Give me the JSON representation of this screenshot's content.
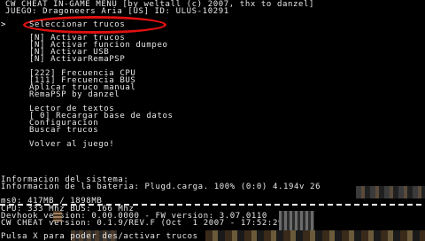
{
  "header": {
    "title": "CW CHEAT IN-GAME MENU [by weltall (c) 2007, thx to danzel]",
    "game": "JUEGO: Dragoneers Aria [US] ID: ULUS-10291"
  },
  "menu": {
    "cursor": ">",
    "items": [
      {
        "label": "Seleccionar trucos"
      },
      {
        "label": "[N] Activar trucos"
      },
      {
        "label": "[N] Activar funcion dumpeo"
      },
      {
        "label": "[N] Activar USB"
      },
      {
        "label": "[N] ActivarRemaPSP"
      },
      {
        "label": "[222] Frecuencia CPU"
      },
      {
        "label": "[111] Frecuencia BUS"
      },
      {
        "label": "Aplicar truco manual"
      },
      {
        "label": "RemaPSP by danzel"
      },
      {
        "label": "Lector de textos"
      },
      {
        "label": "[ 0] Recargar base de datos"
      },
      {
        "label": "Configuracion"
      },
      {
        "label": "Buscar trucos"
      },
      {
        "label": "Volver al juego!"
      }
    ]
  },
  "system": {
    "heading": "Informacion del sistema:",
    "battery": "Informacion de la bateria: Plugd.carga. 100% (0:0) 4.194v 26",
    "memory": "ms0: 417MB / 1898MB",
    "cpu": "CPU: 333 Mhz BUS: 166 Mhz",
    "devhook": "Devhook version: 0.00.0000 - FW version: 3.07.0110",
    "cwcheat": "CW CHEAT version: 0.1.9/REV.F (Oct  1 2007 - 17:52:29)"
  },
  "footer": {
    "hint": "Pulsa X para poder des/activar trucos"
  },
  "colors": {
    "text": "#e8e8e8",
    "background": "#000000",
    "highlight_ring": "#e01010"
  }
}
